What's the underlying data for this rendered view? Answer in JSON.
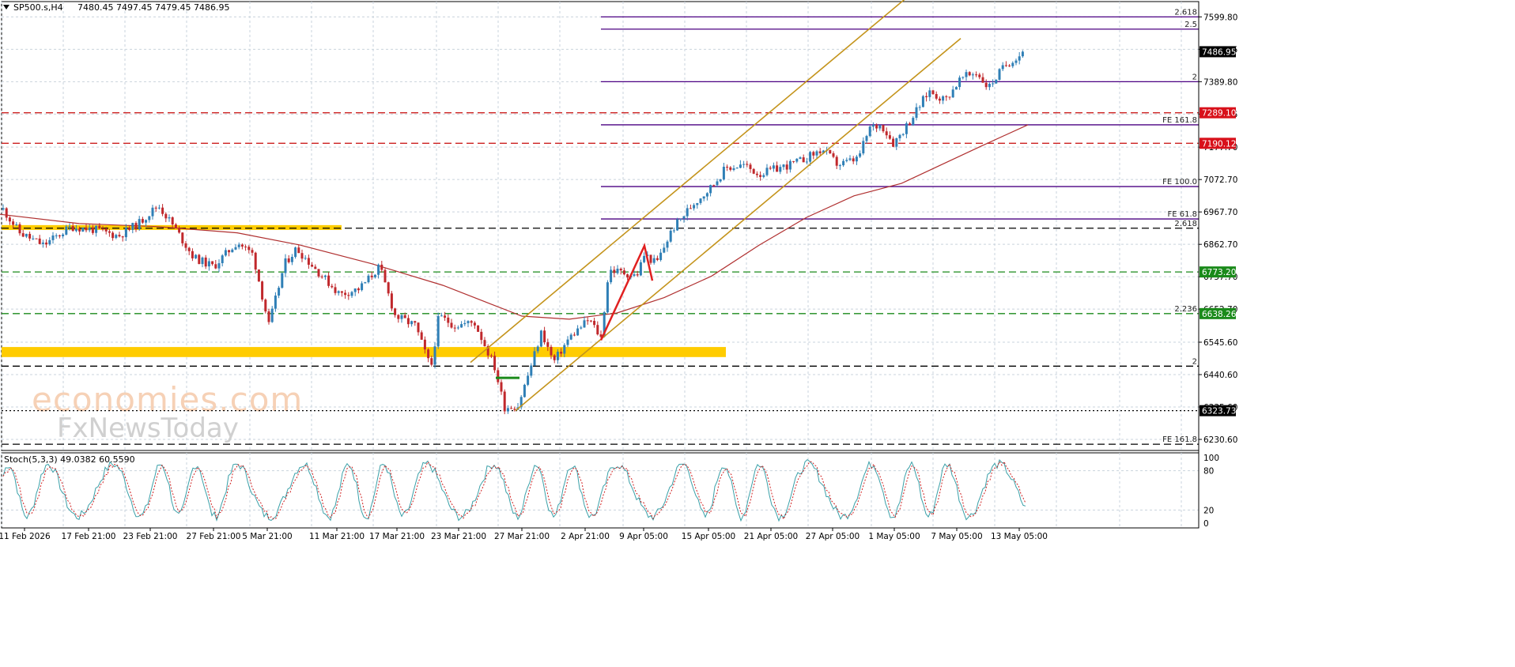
{
  "header": {
    "symbol": "SP500.s,H4",
    "ohlc": "7480.45 7497.45 7479.45 7486.95"
  },
  "watermark": {
    "line1": "economies.com",
    "line2": "FxNewsToday"
  },
  "indicator": {
    "label": "Stoch(5,3,3) 49.0382 60.5590"
  },
  "chart_data": [
    {
      "type": "candlestick",
      "instrument": "SP500.s",
      "timeframe": "H4",
      "ylim": [
        6180,
        7680
      ],
      "y_ticks": [
        "7599.80",
        "7494.75",
        "7389.80",
        "7284.75",
        "7177.70",
        "7072.70",
        "6967.70",
        "6862.70",
        "6757.70",
        "6652.70",
        "6545.60",
        "6440.60",
        "6335.60",
        "6230.60"
      ],
      "x_tick_labels": [
        "11 Feb 2026",
        "17 Feb 21:00",
        "23 Feb 21:00",
        "27 Feb 21:00",
        "5 Mar 21:00",
        "11 Mar 21:00",
        "17 Mar 21:00",
        "23 Mar 21:00",
        "27 Mar 21:00",
        "2 Apr 21:00",
        "9 Apr 05:00",
        "15 Apr 05:00",
        "21 Apr 05:00",
        "27 Apr 05:00",
        "1 May 05:00",
        "7 May 05:00",
        "13 May 05:00"
      ],
      "price_anchors": [
        {
          "x": 0,
          "p": 6990
        },
        {
          "x": 25,
          "p": 6900
        },
        {
          "x": 55,
          "p": 6860
        },
        {
          "x": 90,
          "p": 6920
        },
        {
          "x": 120,
          "p": 6910
        },
        {
          "x": 150,
          "p": 6890
        },
        {
          "x": 175,
          "p": 6930
        },
        {
          "x": 200,
          "p": 6990
        },
        {
          "x": 220,
          "p": 6920
        },
        {
          "x": 245,
          "p": 6820
        },
        {
          "x": 270,
          "p": 6790
        },
        {
          "x": 300,
          "p": 6870
        },
        {
          "x": 320,
          "p": 6830
        },
        {
          "x": 340,
          "p": 6600
        },
        {
          "x": 360,
          "p": 6800
        },
        {
          "x": 375,
          "p": 6850
        },
        {
          "x": 400,
          "p": 6780
        },
        {
          "x": 430,
          "p": 6700
        },
        {
          "x": 455,
          "p": 6720
        },
        {
          "x": 480,
          "p": 6790
        },
        {
          "x": 500,
          "p": 6630
        },
        {
          "x": 525,
          "p": 6600
        },
        {
          "x": 545,
          "p": 6460
        },
        {
          "x": 555,
          "p": 6630
        },
        {
          "x": 575,
          "p": 6600
        },
        {
          "x": 600,
          "p": 6610
        },
        {
          "x": 625,
          "p": 6470
        },
        {
          "x": 638,
          "p": 6335
        },
        {
          "x": 655,
          "p": 6340
        },
        {
          "x": 668,
          "p": 6440
        },
        {
          "x": 685,
          "p": 6580
        },
        {
          "x": 700,
          "p": 6480
        },
        {
          "x": 720,
          "p": 6560
        },
        {
          "x": 745,
          "p": 6620
        },
        {
          "x": 760,
          "p": 6560
        },
        {
          "x": 770,
          "p": 6780
        },
        {
          "x": 790,
          "p": 6770
        },
        {
          "x": 805,
          "p": 6760
        },
        {
          "x": 815,
          "p": 6830
        },
        {
          "x": 830,
          "p": 6800
        },
        {
          "x": 850,
          "p": 6910
        },
        {
          "x": 875,
          "p": 6990
        },
        {
          "x": 900,
          "p": 7050
        },
        {
          "x": 918,
          "p": 7110
        },
        {
          "x": 940,
          "p": 7120
        },
        {
          "x": 960,
          "p": 7090
        },
        {
          "x": 985,
          "p": 7110
        },
        {
          "x": 1010,
          "p": 7130
        },
        {
          "x": 1040,
          "p": 7170
        },
        {
          "x": 1060,
          "p": 7120
        },
        {
          "x": 1085,
          "p": 7140
        },
        {
          "x": 1100,
          "p": 7240
        },
        {
          "x": 1115,
          "p": 7250
        },
        {
          "x": 1130,
          "p": 7190
        },
        {
          "x": 1150,
          "p": 7260
        },
        {
          "x": 1175,
          "p": 7360
        },
        {
          "x": 1195,
          "p": 7330
        },
        {
          "x": 1215,
          "p": 7400
        },
        {
          "x": 1235,
          "p": 7420
        },
        {
          "x": 1250,
          "p": 7370
        },
        {
          "x": 1270,
          "p": 7440
        },
        {
          "x": 1285,
          "p": 7470
        },
        {
          "x": 1297,
          "p": 7487
        }
      ],
      "moving_average": [
        {
          "x": 0,
          "p": 6960
        },
        {
          "x": 100,
          "p": 6930
        },
        {
          "x": 200,
          "p": 6920
        },
        {
          "x": 300,
          "p": 6900
        },
        {
          "x": 380,
          "p": 6860
        },
        {
          "x": 470,
          "p": 6800
        },
        {
          "x": 560,
          "p": 6730
        },
        {
          "x": 620,
          "p": 6670
        },
        {
          "x": 660,
          "p": 6630
        },
        {
          "x": 720,
          "p": 6620
        },
        {
          "x": 780,
          "p": 6640
        },
        {
          "x": 840,
          "p": 6690
        },
        {
          "x": 900,
          "p": 6760
        },
        {
          "x": 960,
          "p": 6860
        },
        {
          "x": 1020,
          "p": 6950
        },
        {
          "x": 1080,
          "p": 7020
        },
        {
          "x": 1140,
          "p": 7060
        },
        {
          "x": 1190,
          "p": 7120
        },
        {
          "x": 1240,
          "p": 7180
        },
        {
          "x": 1300,
          "p": 7250
        }
      ],
      "moving_average_color": "#b03030",
      "bull_color": "#2f7fb6",
      "bear_color": "#c0282c",
      "channel": {
        "color": "#c4941c",
        "upper": {
          "from": {
            "x": 595,
            "p": 6480
          },
          "to": {
            "x": 1155,
            "p": 7680
          }
        },
        "lower": {
          "from": {
            "x": 652,
            "p": 6323.73
          },
          "to": {
            "x": 1215,
            "p": 7530
          }
        }
      },
      "wave_path": [
        {
          "x": 760,
          "p": 6552
        },
        {
          "x": 815,
          "p": 6858
        },
        {
          "x": 825,
          "p": 6745
        }
      ],
      "wave_color": "#e02020",
      "price_labels": [
        {
          "price": 7486.95,
          "text": "7486.95",
          "bg": "#000000"
        },
        {
          "price": 7289.1,
          "text": "7289.10",
          "bg": "#d8101a"
        },
        {
          "price": 7190.12,
          "text": "7190.12",
          "bg": "#d8101a"
        },
        {
          "price": 6773.2,
          "text": "6773.20",
          "bg": "#1a8a1a"
        },
        {
          "price": 6638.26,
          "text": "6638.26",
          "bg": "#1a8a1a"
        },
        {
          "price": 6323.73,
          "text": "6323.73",
          "bg": "#000000"
        }
      ],
      "horizontal_levels": [
        {
          "price": 7599.8,
          "label": "2.618",
          "color": "#4b0082",
          "style": "solid",
          "x_start": 760
        },
        {
          "price": 7560,
          "label": "2.5",
          "color": "#4b0082",
          "style": "solid",
          "x_start": 760
        },
        {
          "price": 7389.8,
          "label": "2",
          "color": "#4b0082",
          "style": "solid",
          "x_start": 760
        },
        {
          "price": 7289.1,
          "label": "",
          "color": "#cc2020",
          "style": "dash",
          "x_start": 0
        },
        {
          "price": 7250,
          "label": "FE 161.8",
          "color": "#4b0082",
          "style": "solid",
          "x_start": 760
        },
        {
          "price": 7190.12,
          "label": "",
          "color": "#cc2020",
          "style": "dash",
          "x_start": 0
        },
        {
          "price": 7050,
          "label": "FE 100.0",
          "color": "#4b0082",
          "style": "solid",
          "x_start": 760
        },
        {
          "price": 6945,
          "label": "FE 61.8",
          "color": "#4b0082",
          "style": "solid",
          "x_start": 760
        },
        {
          "price": 6915,
          "label": "2.618",
          "color": "#000000",
          "style": "dash",
          "x_start": 0
        },
        {
          "price": 6773.2,
          "label": "",
          "color": "#1a8a1a",
          "style": "dash",
          "x_start": 0
        },
        {
          "price": 6638.26,
          "label": "2.236",
          "color": "#1a8a1a",
          "style": "dash",
          "x_start": 0
        },
        {
          "price": 6468,
          "label": "2",
          "color": "#000000",
          "style": "dash",
          "x_start": 0
        },
        {
          "price": 6323.73,
          "label": "",
          "color": "#000000",
          "style": "dot",
          "x_start": 0
        },
        {
          "price": 6215,
          "label": "FE 161.8",
          "color": "#000000",
          "style": "dash",
          "x_start": 0
        }
      ],
      "zones": [
        {
          "from": 6925,
          "to": 6912,
          "x_end": 432,
          "color": "#ffcc00"
        },
        {
          "from": 6530,
          "to": 6500,
          "x_end": 918,
          "color": "#ffcc00"
        }
      ],
      "small_marker": {
        "x1": 627,
        "x2": 657,
        "p": 6430,
        "color": "#1a8a1a"
      }
    },
    {
      "type": "line",
      "name": "Stoch(5,3,3)",
      "ylim": [
        0,
        100
      ],
      "y_ticks": [
        "100",
        "80",
        "20",
        "0"
      ],
      "main_color": "#3aa0a8",
      "signal_color": "#d02020",
      "levels": [
        80,
        20
      ]
    }
  ]
}
